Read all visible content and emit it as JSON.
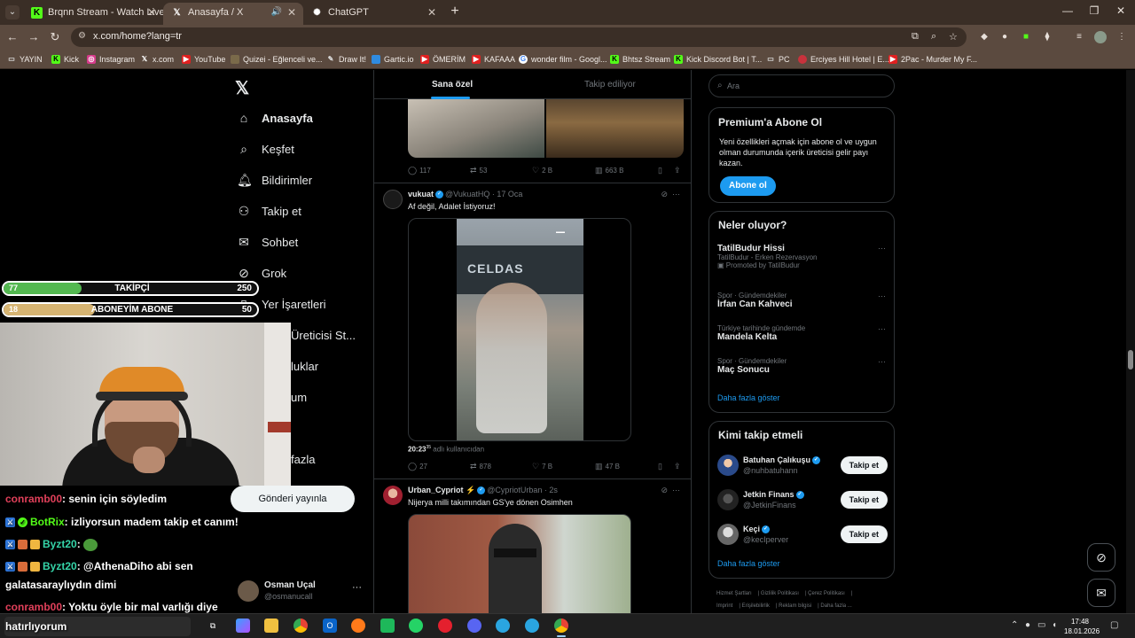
{
  "browser": {
    "tabs": [
      {
        "title": "Brqnn Stream - Watch Live on K",
        "icon": "kick-icon"
      },
      {
        "title": "Anasayfa / X",
        "icon": "x-icon"
      },
      {
        "title": "ChatGPT",
        "icon": "chatgpt-icon"
      }
    ],
    "url": "x.com/home?lang=tr",
    "bookmarks": [
      "YAYIN",
      "Kick",
      "Instagram",
      "x.com",
      "YouTube",
      "Quizei - Eğlenceli ve...",
      "Draw It!",
      "Gartic.io",
      "ÖMERİM",
      "KAFAAA",
      "wonder film - Googl...",
      "Bhtsz Stream",
      "Kick Discord Bot | T...",
      "PC",
      "Erciyes Hill Hotel | E...",
      "2Pac - Murder My F..."
    ]
  },
  "nav": {
    "items": [
      {
        "label": "Anasayfa",
        "icon": "home-icon"
      },
      {
        "label": "Keşfet",
        "icon": "search-icon"
      },
      {
        "label": "Bildirimler",
        "icon": "bell-icon"
      },
      {
        "label": "Takip et",
        "icon": "person-add-icon"
      },
      {
        "label": "Sohbet",
        "icon": "mail-icon"
      },
      {
        "label": "Grok",
        "icon": "grok-icon"
      },
      {
        "label": "Yer İşaretleri",
        "icon": "bookmark-icon"
      },
      {
        "label": "Üreticisi St..."
      },
      {
        "label": "luklar"
      },
      {
        "label": "um"
      },
      {
        "label": "fazla"
      }
    ],
    "post_button": "Gönderi yayınla",
    "account": {
      "name": "Osman Uçal",
      "handle": "@osmanucall"
    }
  },
  "timeline": {
    "tabs": [
      "Sana özel",
      "Takip ediliyor"
    ],
    "tweet0_actions": {
      "replies": "117",
      "reposts": "53",
      "likes": "2 B",
      "views": "663 B"
    },
    "tweet1": {
      "name": "vukuat",
      "handle": "@VukuatHQ",
      "date": "· 17 Oca",
      "text": "Af değil, Adalet İstiyoruz!",
      "video_sign": "CELDAS",
      "video_time": "20:23",
      "video_time_sup": "35",
      "video_caption": "adlı kullanıcıdan",
      "replies": "27",
      "reposts": "878",
      "likes": "7 B",
      "views": "47 B"
    },
    "tweet2": {
      "name": "Urban_Cypriot ⚡",
      "handle": "@CypriotUrban",
      "date": "· 2s",
      "text": "Nijerya milli takımından GS'ye dönen Osimhen"
    }
  },
  "right": {
    "search_placeholder": "Ara",
    "premium": {
      "title": "Premium'a Abone Ol",
      "text": "Yeni özellikleri açmak için abone ol ve uygun olman durumunda içerik üreticisi gelir payı kazan.",
      "button": "Abone ol"
    },
    "trends": {
      "title": "Neler oluyor?",
      "items": [
        {
          "context": "",
          "title": "TatilBudur Hissi",
          "sub": "TatilBudur - Erken Rezervasyon",
          "sub2": "Promoted by TatilBudur"
        },
        {
          "context": "Spor · Gündemdekiler",
          "title": "İrfan Can Kahveci",
          "sub": "",
          "sub2": ""
        },
        {
          "context": "Türkiye tarihinde gündemde",
          "title": "Mandela Kelta",
          "sub": "",
          "sub2": ""
        },
        {
          "context": "Spor · Gündemdekiler",
          "title": "Maç Sonucu",
          "sub": "",
          "sub2": ""
        }
      ],
      "more": "Daha fazla göster"
    },
    "who_to_follow": {
      "title": "Kimi takip etmeli",
      "items": [
        {
          "name": "Batuhan Çalıkuşu",
          "handle": "@nuhbatuhann",
          "button": "Takip et"
        },
        {
          "name": "Jetkin Finans",
          "handle": "@JetkinFinans",
          "button": "Takip et"
        },
        {
          "name": "Keçi",
          "handle": "@kecIperver",
          "button": "Takip et"
        }
      ],
      "more": "Daha fazla göster"
    },
    "footer": [
      "Hizmet Şartları",
      "Gizlilik Politikası",
      "Çerez Politikası",
      "Imprint",
      "Erişilebilirlik",
      "Reklam bilgisi",
      "Daha fazla ..."
    ]
  },
  "overlay": {
    "followers": {
      "current": "77",
      "label": "TAKİPÇİ",
      "goal": "250",
      "progress": 0.308,
      "color": "#53b850"
    },
    "subs": {
      "current": "18",
      "label": "ABONEYİM ABONE",
      "goal": "50",
      "progress": 0.36,
      "color": "#d6b472"
    },
    "chat": [
      {
        "user": "conramb00",
        "color": "#e0405a",
        "text": ": senin için söyledim"
      },
      {
        "user": "BotRix",
        "color": "#53fc18",
        "text": ": izliyorsun madem takip et canım!"
      },
      {
        "user": "Byzt20",
        "color": "#35d4a8",
        "text": ":"
      },
      {
        "user": "Byzt20",
        "color": "#35d4a8",
        "text": ": @AthenaDiho abi sen"
      },
      {
        "user": "",
        "color": "#fff",
        "text": "galatasaraylıydın dimi"
      },
      {
        "user": "conramb00",
        "color": "#e0405a",
        "text": ": Yoktu öyle bir mal varlığı diye"
      },
      {
        "user": "",
        "color": "#fff",
        "text": "hatırlıyorum"
      }
    ]
  },
  "taskbar": {
    "time": "17:48",
    "date": "18.01.2026"
  }
}
